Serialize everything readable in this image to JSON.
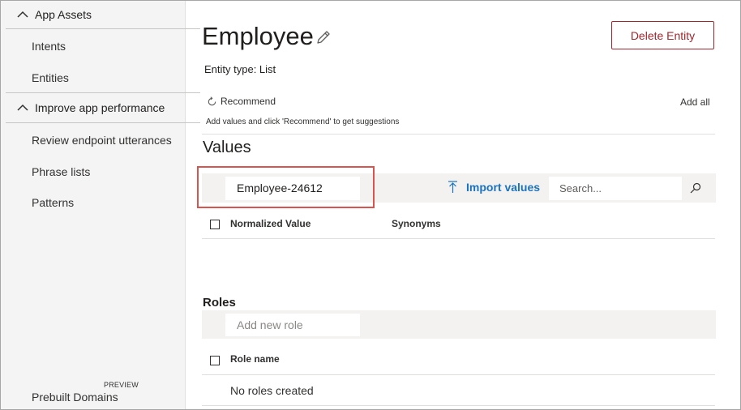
{
  "sidebar": {
    "sections": [
      {
        "title": "App Assets",
        "items": [
          "Intents",
          "Entities"
        ]
      },
      {
        "title": "Improve app performance",
        "items": [
          "Review endpoint utterances",
          "Phrase lists",
          "Patterns"
        ]
      }
    ],
    "bottom_item": {
      "label": "Prebuilt Domains",
      "badge": "PREVIEW"
    }
  },
  "entity": {
    "name": "Employee",
    "type_label": "Entity type: List",
    "delete_label": "Delete Entity"
  },
  "recommend": {
    "label": "Recommend",
    "add_all_label": "Add all",
    "hint": "Add values and click 'Recommend' to get suggestions"
  },
  "values": {
    "title": "Values",
    "input_value": "Employee-24612",
    "import_label": "Import values",
    "search_placeholder": "Search...",
    "columns": [
      "Normalized Value",
      "Synonyms"
    ]
  },
  "roles": {
    "title": "Roles",
    "input_placeholder": "Add new role",
    "column": "Role name",
    "empty_text": "No roles created"
  },
  "colors": {
    "accent": "#1a73c0",
    "danger": "#a4262c",
    "highlight": "#d9534f"
  }
}
